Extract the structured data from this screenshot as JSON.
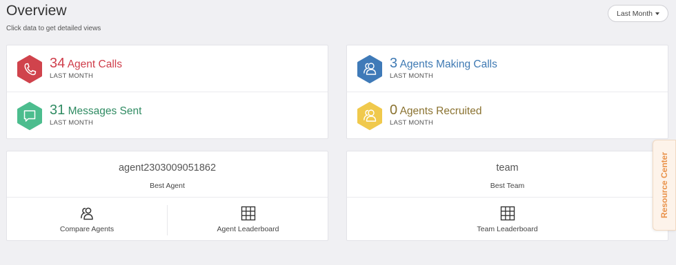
{
  "header": {
    "title": "Overview",
    "subtitle": "Click data to get detailed views",
    "period_label": "Last Month"
  },
  "stats": {
    "agent_calls": {
      "value": "34",
      "label": "Agent Calls",
      "period": "LAST MONTH",
      "color": "#d0434c",
      "icon": "phone-icon"
    },
    "agents_making_calls": {
      "value": "3",
      "label": "Agents Making Calls",
      "period": "LAST MONTH",
      "color": "#3f7ab8",
      "icon": "users-icon"
    },
    "messages_sent": {
      "value": "31",
      "label": "Messages Sent",
      "period": "LAST MONTH",
      "color": "#4cbd8e",
      "icon": "message-icon"
    },
    "agents_recruited": {
      "value": "0",
      "label": "Agents Recruited",
      "period": "LAST MONTH",
      "color": "#f0c94c",
      "icon": "users-icon"
    }
  },
  "best_agent": {
    "name": "agent2303009051862",
    "label": "Best Agent",
    "actions": [
      {
        "label": "Compare Agents",
        "icon": "compare-users-icon"
      },
      {
        "label": "Agent Leaderboard",
        "icon": "grid-icon"
      }
    ]
  },
  "best_team": {
    "name": "team",
    "label": "Best Team",
    "actions": [
      {
        "label": "Team Leaderboard",
        "icon": "grid-icon"
      }
    ]
  },
  "resource_center": {
    "label": "Resource Center"
  }
}
